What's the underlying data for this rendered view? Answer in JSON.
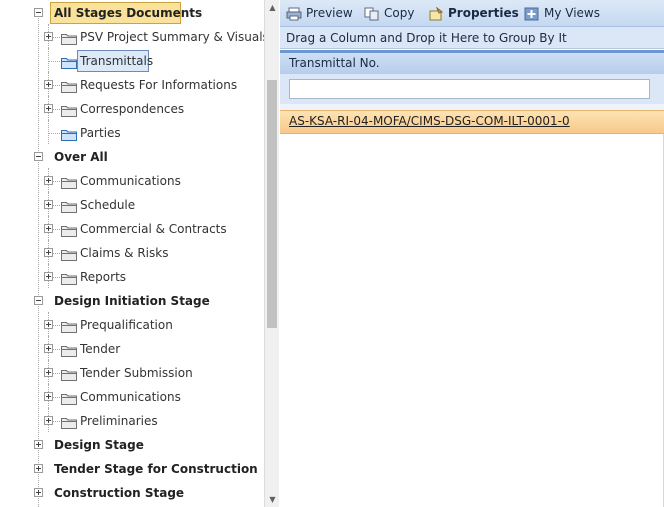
{
  "tree": {
    "nodes": [
      {
        "label": "All Stages Documents",
        "level": 0,
        "expander": "minus",
        "selected": "yellow"
      },
      {
        "label": "PSV Project Summary & Visuals",
        "level": 1,
        "expander": "plus"
      },
      {
        "label": "Transmittals",
        "level": 1,
        "expander": "none",
        "selected": "blue",
        "icon": "folder-blue"
      },
      {
        "label": "Requests For Informations",
        "level": 1,
        "expander": "plus"
      },
      {
        "label": "Correspondences",
        "level": 1,
        "expander": "plus"
      },
      {
        "label": "Parties",
        "level": 1,
        "expander": "none",
        "icon": "folder-blue"
      },
      {
        "label": "Over All",
        "level": 0,
        "expander": "minus"
      },
      {
        "label": "Communications",
        "level": 1,
        "expander": "plus"
      },
      {
        "label": "Schedule",
        "level": 1,
        "expander": "plus"
      },
      {
        "label": "Commercial & Contracts",
        "level": 1,
        "expander": "plus"
      },
      {
        "label": "Claims & Risks",
        "level": 1,
        "expander": "plus"
      },
      {
        "label": "Reports",
        "level": 1,
        "expander": "plus"
      },
      {
        "label": "Design Initiation Stage",
        "level": 0,
        "expander": "minus"
      },
      {
        "label": "Prequalification",
        "level": 1,
        "expander": "plus"
      },
      {
        "label": "Tender",
        "level": 1,
        "expander": "plus"
      },
      {
        "label": "Tender Submission",
        "level": 1,
        "expander": "plus"
      },
      {
        "label": "Communications",
        "level": 1,
        "expander": "plus"
      },
      {
        "label": "Preliminaries",
        "level": 1,
        "expander": "plus"
      },
      {
        "label": "Design Stage",
        "level": 0,
        "expander": "plus"
      },
      {
        "label": "Tender Stage for Construction",
        "level": 0,
        "expander": "plus"
      },
      {
        "label": "Construction Stage",
        "level": 0,
        "expander": "plus"
      }
    ]
  },
  "toolbar": {
    "preview": "Preview",
    "copy": "Copy",
    "properties": "Properties",
    "my_views": "My Views"
  },
  "grid": {
    "group_hint": "Drag a Column and Drop it Here to Group By It",
    "column_header": "Transmittal No.",
    "filter_value": "",
    "rows": [
      "AS-KSA-RI-04-MOFA/CIMS-DSG-COM-ILT-0001-0"
    ]
  },
  "colors": {
    "selection_yellow": "#fbe29b",
    "selection_blue": "#dbe9f8",
    "row_highlight": "#f8c98a",
    "toolbar_blue": "#c5d8f0"
  }
}
